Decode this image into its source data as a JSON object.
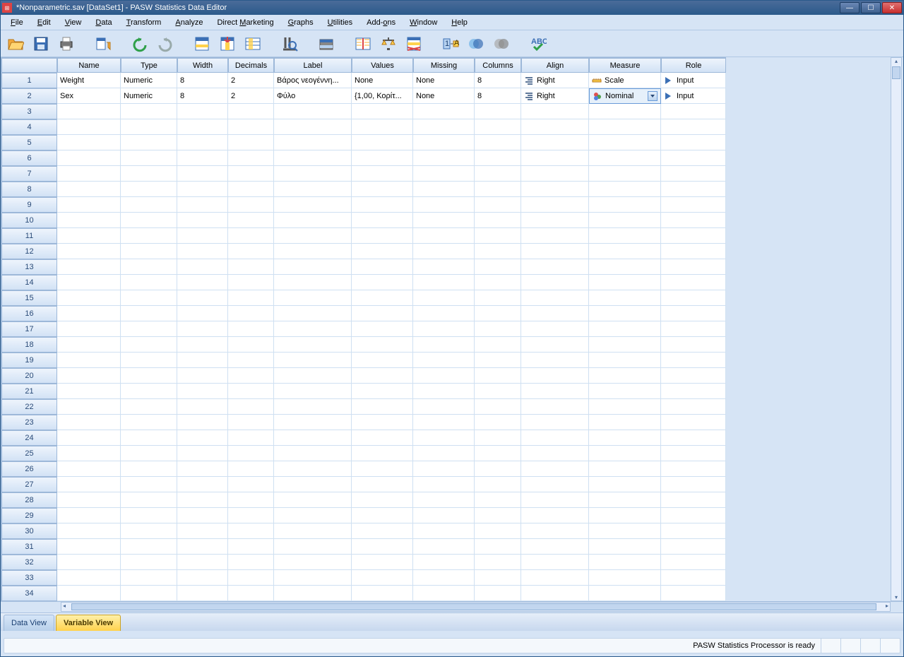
{
  "window": {
    "title": "*Nonparametric.sav [DataSet1] - PASW Statistics Data Editor"
  },
  "menu": [
    "File",
    "Edit",
    "View",
    "Data",
    "Transform",
    "Analyze",
    "Direct Marketing",
    "Graphs",
    "Utilities",
    "Add-ons",
    "Window",
    "Help"
  ],
  "toolbar": {
    "items": [
      "open",
      "save",
      "print",
      "recall",
      "undo",
      "redo",
      "goto-case",
      "goto-var",
      "variables",
      "find",
      "insert-case",
      "split",
      "weight",
      "select",
      "value-labels",
      "use-sets",
      "customize",
      "show-all",
      "spellcheck"
    ]
  },
  "columns": [
    "Name",
    "Type",
    "Width",
    "Decimals",
    "Label",
    "Values",
    "Missing",
    "Columns",
    "Align",
    "Measure",
    "Role"
  ],
  "rows": [
    {
      "n": "1",
      "name": "Weight",
      "type": "Numeric",
      "width": "8",
      "decimals": "2",
      "label": "Βάρος νεογέννη...",
      "values": "None",
      "missing": "None",
      "columns": "8",
      "align": "Right",
      "measure": "Scale",
      "role": "Input",
      "selected": false
    },
    {
      "n": "2",
      "name": "Sex",
      "type": "Numeric",
      "width": "8",
      "decimals": "2",
      "label": "Φύλο",
      "values": "{1,00, Κορίτ...",
      "missing": "None",
      "columns": "8",
      "align": "Right",
      "measure": "Nominal",
      "role": "Input",
      "selected": true
    }
  ],
  "emptyRows": 32,
  "tabs": {
    "data": "Data View",
    "variable": "Variable View"
  },
  "status": "PASW Statistics Processor is ready"
}
